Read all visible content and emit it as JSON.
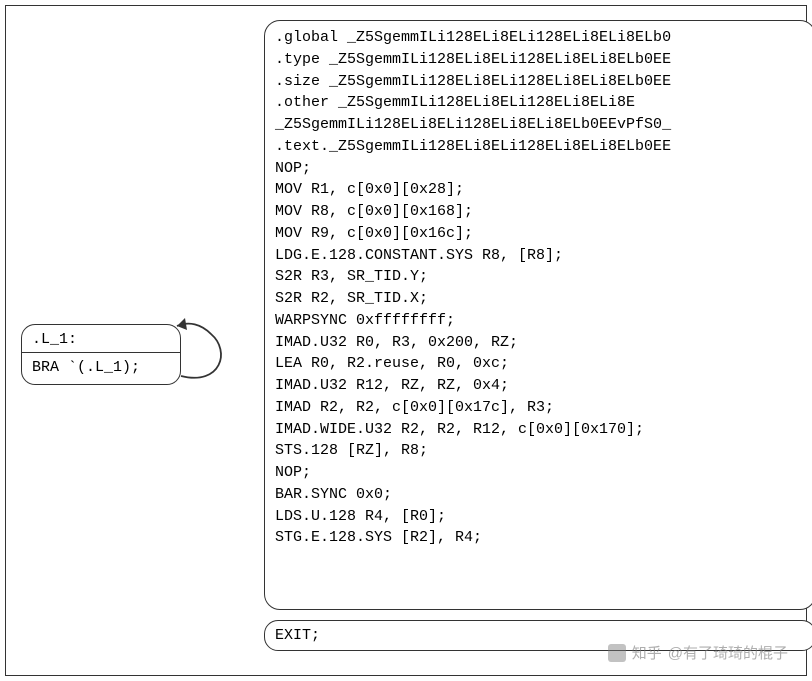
{
  "left_block": {
    "label": ".L_1:",
    "instr": "BRA `(.L_1);"
  },
  "main_block_lines": [
    ".global _Z5SgemmILi128ELi8ELi128ELi8ELi8ELb0",
    ".type _Z5SgemmILi128ELi8ELi128ELi8ELi8ELb0EE",
    ".size _Z5SgemmILi128ELi8ELi128ELi8ELi8ELb0EE",
    "    .other _Z5SgemmILi128ELi8ELi128ELi8ELi8E",
    "_Z5SgemmILi128ELi8ELi128ELi8ELi8ELb0EEvPfS0_",
    ".text._Z5SgemmILi128ELi8ELi128ELi8ELi8ELb0EE",
    " NOP;",
    " MOV R1, c[0x0][0x28];",
    " MOV R8, c[0x0][0x168];",
    " MOV R9, c[0x0][0x16c];",
    " LDG.E.128.CONSTANT.SYS R8, [R8];",
    " S2R R3, SR_TID.Y;",
    " S2R R2, SR_TID.X;",
    " WARPSYNC 0xffffffff;",
    " IMAD.U32 R0, R3, 0x200, RZ;",
    " LEA R0, R2.reuse, R0, 0xc;",
    " IMAD.U32 R12, RZ, RZ, 0x4;",
    " IMAD R2, R2, c[0x0][0x17c], R3;",
    " IMAD.WIDE.U32 R2, R2, R12, c[0x0][0x170];",
    " STS.128 [RZ], R8;",
    " NOP;",
    " BAR.SYNC 0x0;",
    " LDS.U.128 R4, [R0];",
    " STG.E.128.SYS [R2], R4;"
  ],
  "exit_block": {
    "text": " EXIT;"
  },
  "watermark": {
    "text": "@有了琦琦的棍子",
    "prefix": "知乎"
  }
}
